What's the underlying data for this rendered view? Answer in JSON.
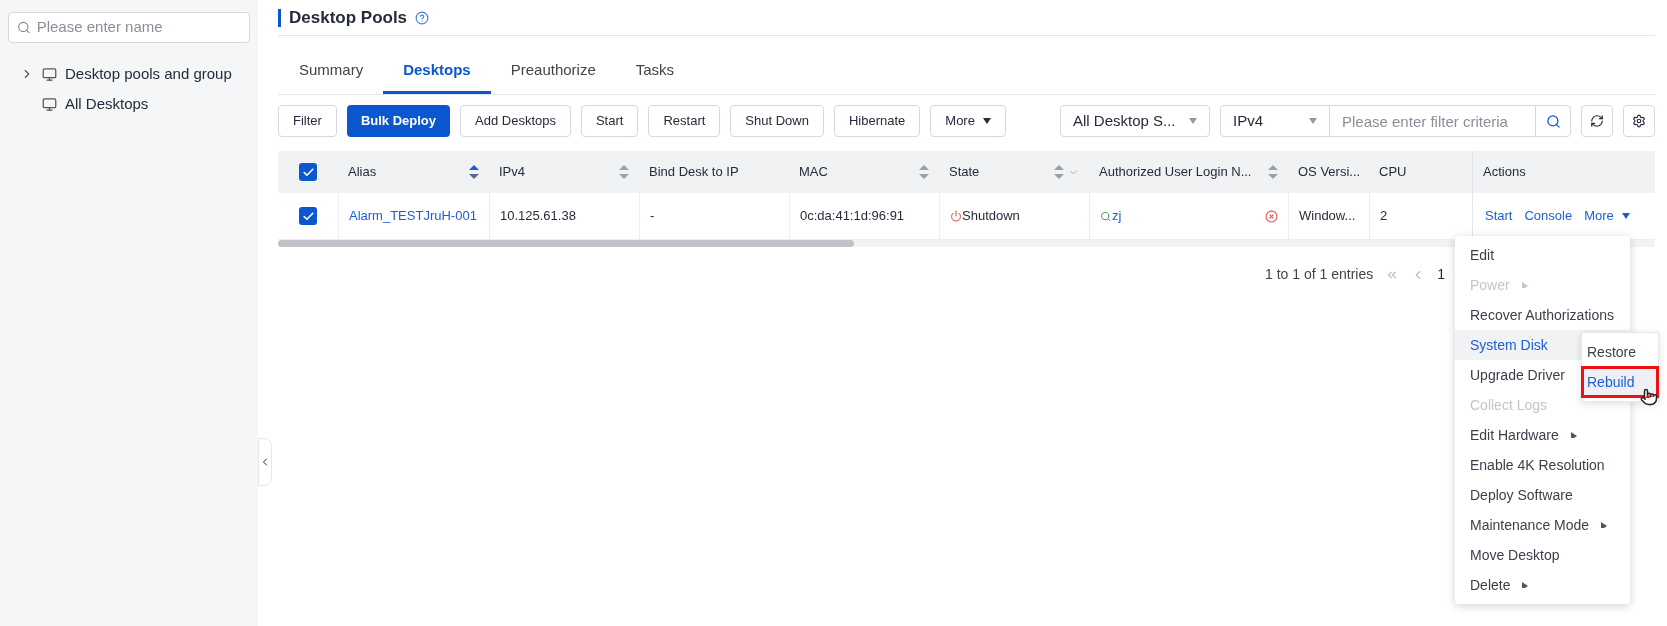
{
  "sidebar": {
    "search": {
      "placeholder": "Please enter name"
    },
    "tree": [
      {
        "kind": "group",
        "label": "Desktop pools and group",
        "expanded": false
      },
      {
        "kind": "leaf",
        "label": "All Desktops"
      }
    ]
  },
  "page": {
    "title": "Desktop Pools",
    "help_icon": true
  },
  "tabs": [
    {
      "label": "Summary",
      "selected": false
    },
    {
      "label": "Desktops",
      "selected": true
    },
    {
      "label": "Preauthorize",
      "selected": false
    },
    {
      "label": "Tasks",
      "selected": false
    }
  ],
  "toolbar": {
    "buttons": [
      {
        "label": "Filter",
        "primary": false,
        "dropdown": false
      },
      {
        "label": "Bulk Deploy",
        "primary": true,
        "dropdown": false
      },
      {
        "label": "Add Desktops",
        "primary": false,
        "dropdown": false
      },
      {
        "label": "Start",
        "primary": false,
        "dropdown": false
      },
      {
        "label": "Restart",
        "primary": false,
        "dropdown": false
      },
      {
        "label": "Shut Down",
        "primary": false,
        "dropdown": false
      },
      {
        "label": "Hibernate",
        "primary": false,
        "dropdown": false
      },
      {
        "label": "More",
        "primary": false,
        "dropdown": true
      }
    ],
    "state_select": "All Desktop S...",
    "field_select": "IPv4",
    "filter": {
      "placeholder": "Please enter filter criteria"
    }
  },
  "table": {
    "all_checked": true,
    "columns": [
      {
        "label": "Alias",
        "sortable": true,
        "sorted": true,
        "filterable": false
      },
      {
        "label": "IPv4",
        "sortable": true,
        "sorted": false,
        "filterable": false
      },
      {
        "label": "Bind Desk to IP",
        "sortable": false,
        "filterable": false
      },
      {
        "label": "MAC",
        "sortable": true,
        "sorted": false,
        "filterable": false
      },
      {
        "label": "State",
        "sortable": true,
        "sorted": false,
        "filterable": true
      },
      {
        "label": "Authorized User Login N...",
        "sortable": true,
        "sorted": false,
        "filterable": false
      },
      {
        "label": "OS Versi...",
        "sortable": false,
        "filterable": false
      },
      {
        "label": "CPU",
        "sortable": false,
        "filterable": false
      },
      {
        "label": "Actions",
        "sortable": false,
        "filterable": false
      }
    ],
    "rows": [
      {
        "checked": true,
        "alias": "Alarm_TESTJruH-001",
        "ipv4": "10.125.61.38",
        "bind": "-",
        "mac": "0c:da:41:1d:96:91",
        "state": "Shutdown",
        "user": "zj",
        "os": "Window...",
        "cpu": "2",
        "actions": [
          "Start",
          "Console",
          "More"
        ]
      }
    ]
  },
  "pagination": {
    "summary": "1 to 1 of 1 entries",
    "page": "1"
  },
  "menu": {
    "items": [
      {
        "label": "Edit",
        "disabled": false,
        "submenu": false,
        "selected": false
      },
      {
        "label": "Power",
        "disabled": true,
        "submenu": true,
        "selected": false
      },
      {
        "label": "Recover Authorizations",
        "disabled": false,
        "submenu": false,
        "selected": false
      },
      {
        "label": "System Disk",
        "disabled": false,
        "submenu": false,
        "selected": true
      },
      {
        "label": "Upgrade Driver",
        "disabled": false,
        "submenu": false,
        "selected": false
      },
      {
        "label": "Collect Logs",
        "disabled": true,
        "submenu": false,
        "selected": false
      },
      {
        "label": "Edit Hardware",
        "disabled": false,
        "submenu": true,
        "selected": false
      },
      {
        "label": "Enable 4K Resolution",
        "disabled": false,
        "submenu": false,
        "selected": false
      },
      {
        "label": "Deploy Software",
        "disabled": false,
        "submenu": false,
        "selected": false
      },
      {
        "label": "Maintenance Mode",
        "disabled": false,
        "submenu": true,
        "selected": false
      },
      {
        "label": "Move Desktop",
        "disabled": false,
        "submenu": false,
        "selected": false
      },
      {
        "label": "Delete",
        "disabled": false,
        "submenu": true,
        "selected": false
      }
    ],
    "submenu": [
      {
        "label": "Restore",
        "selected": false,
        "highlighted": false
      },
      {
        "label": "Rebuild",
        "selected": true,
        "highlighted": true
      }
    ]
  }
}
